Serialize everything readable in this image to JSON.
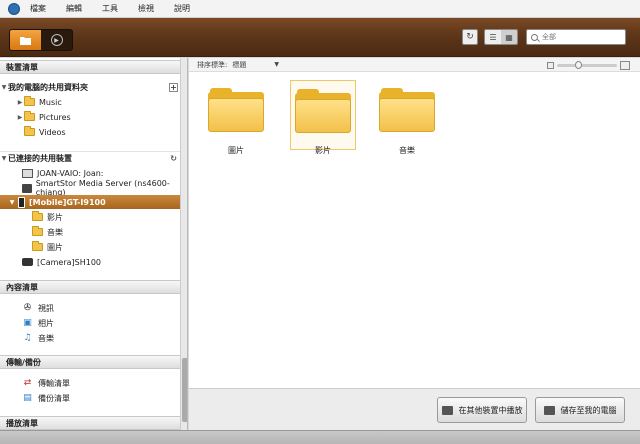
{
  "menu": [
    "檔案",
    "編輯",
    "工具",
    "檢視",
    "說明"
  ],
  "toolbar": {
    "search_placeholder": "全部"
  },
  "sidebar": {
    "devices_header": "裝置清單",
    "my_shared": {
      "label": "我的電腦的共用資料夾",
      "items": [
        "Music",
        "Pictures",
        "Videos"
      ]
    },
    "connected": {
      "label": "已連接的共用裝置",
      "devices": [
        "JOAN-VAIO: Joan:",
        "SmartStor Media Server  (ns4600-chiang)"
      ],
      "selected_device": "[Mobile]GT-I9100",
      "selected_children": [
        "影片",
        "音樂",
        "圖片"
      ],
      "camera": "[Camera]SH100"
    },
    "content_header": "內容清單",
    "content_items": [
      "視訊",
      "相片",
      "音樂"
    ],
    "transfer_header": "傳輸/備份",
    "transfer_items": [
      "傳輸清單",
      "備份清單"
    ],
    "playlist_header": "播放清單"
  },
  "main": {
    "sort_label": "排序標準:",
    "sort_value": "標題",
    "folders": [
      "圖片",
      "影片",
      "音樂"
    ],
    "play_on_other": "在其他裝置中播放",
    "save_to_pc": "儲存至我的電腦"
  }
}
